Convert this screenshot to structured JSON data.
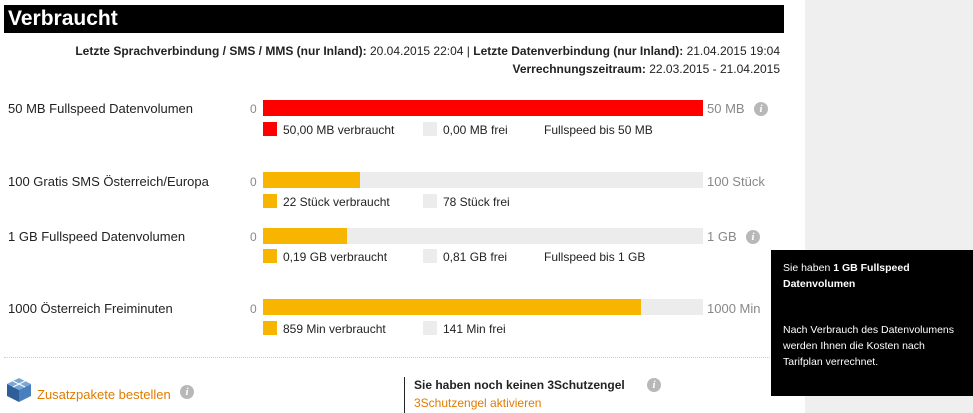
{
  "header": {
    "title": "Verbraucht"
  },
  "meta": {
    "last_voice_label": "Letzte Sprachverbindung / SMS / MMS (nur Inland):",
    "last_voice_value": "20.04.2015 22:04",
    "separator": "|",
    "last_data_label": "Letzte Datenverbindung (nur Inland):",
    "last_data_value": "21.04.2015 19:04",
    "period_label": "Verrechnungszeitraum:",
    "period_value": "22.03.2015 - 21.04.2015"
  },
  "colors": {
    "red": "#ff0000",
    "orange": "#f7b500",
    "gray": "#ececec",
    "link": "#e07b00"
  },
  "rows": [
    {
      "label": "50 MB Fullspeed Datenvolumen",
      "zero": "0",
      "max": "50 MB",
      "fraction": 1.0,
      "color": "#ff0000",
      "used": "50,00 MB verbraucht",
      "free": "0,00 MB frei",
      "extra": "Fullspeed bis 50 MB",
      "info": "i"
    },
    {
      "label": "100 Gratis SMS Österreich/Europa",
      "zero": "0",
      "max": "100 Stück",
      "fraction": 0.22,
      "color": "#f7b500",
      "used": "22 Stück verbraucht",
      "free": "78 Stück frei"
    },
    {
      "label": "1 GB Fullspeed Datenvolumen",
      "zero": "0",
      "max": "1 GB",
      "fraction": 0.19,
      "color": "#f7b500",
      "used": "0,19 GB verbraucht",
      "free": "0,81 GB frei",
      "extra": "Fullspeed bis 1 GB",
      "info": "i"
    },
    {
      "label": "1000 Österreich Freiminuten",
      "zero": "0",
      "max": "1000 Min",
      "fraction": 0.859,
      "color": "#f7b500",
      "used": "859 Min verbraucht",
      "free": "141 Min frei"
    }
  ],
  "footer": {
    "addon_label": "Zusatzpakete bestellen",
    "angel_title": "Sie haben noch keinen 3Schutzengel",
    "angel_link": "3Schutzengel aktivieren",
    "info": "i"
  },
  "tooltip": {
    "line1_prefix": "Sie haben ",
    "line1_bold": "1 GB Fullspeed Datenvolumen",
    "body": "Nach Verbrauch des Datenvolumens werden Ihnen die Kosten nach Tarifplan verrechnet."
  }
}
